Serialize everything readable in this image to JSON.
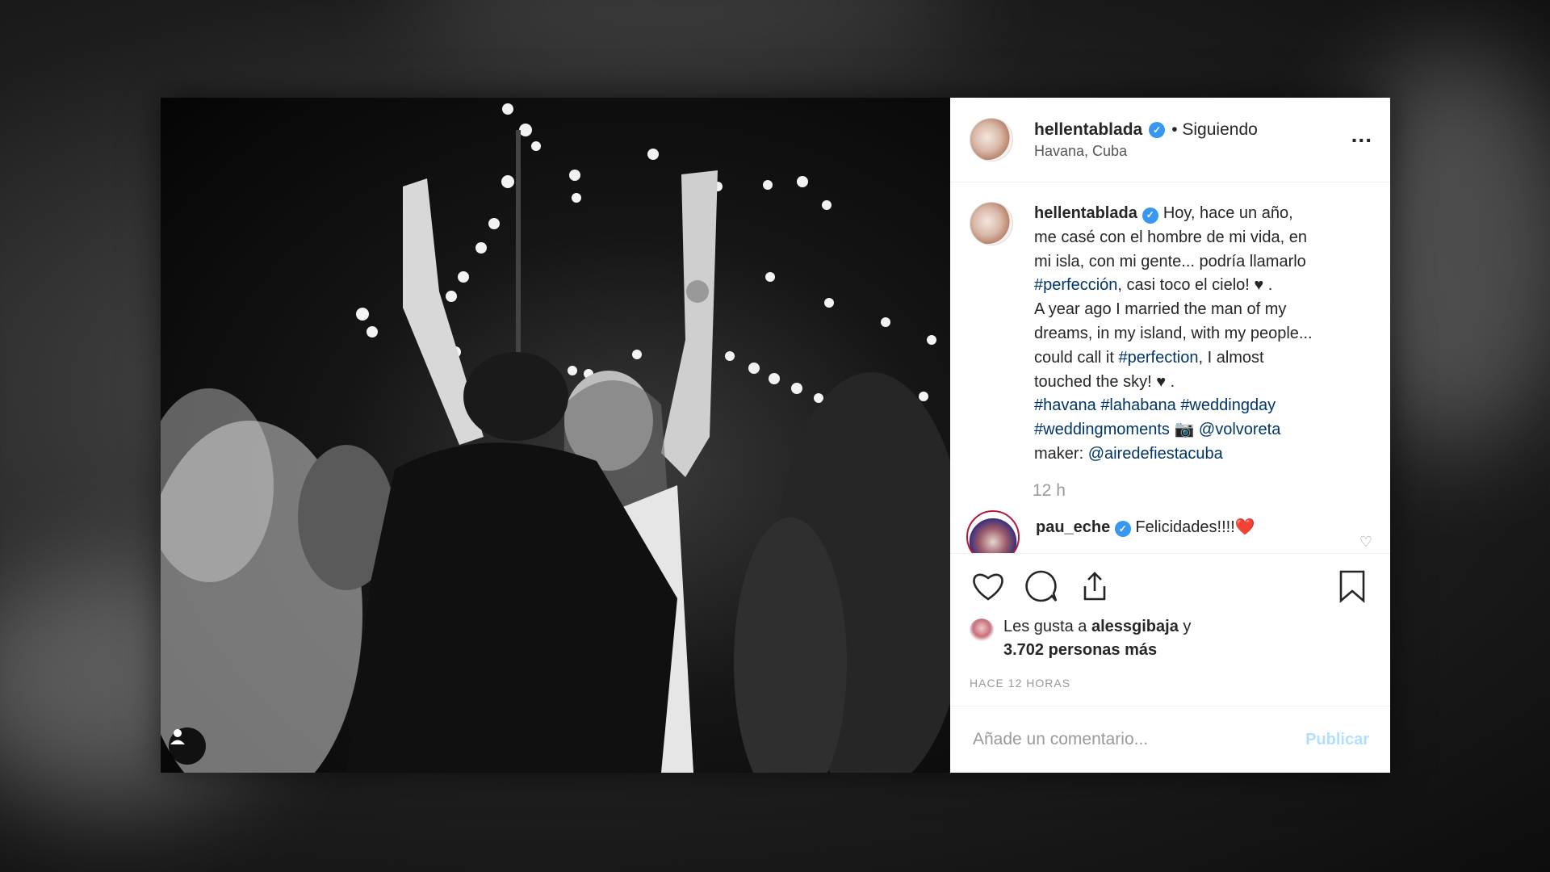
{
  "post": {
    "username": "hellentablada",
    "follow_status": "• Siguiendo",
    "location": "Havana, Cuba",
    "more_label": "...",
    "caption": {
      "username": "hellentablada",
      "line1": "Hoy, hace un año,",
      "line2": "me casé con el hombre de mi vida, en",
      "line3": "mi isla, con mi gente... podría llamarlo",
      "line4_tag": "#perfección",
      "line4_rest": ", casi toco el cielo! ♥ .",
      "line5": "A year ago I married the man of my",
      "line6": "dreams, in my island, with my people...",
      "line7_pre": "could call it ",
      "line7_tag": "#perfection",
      "line7_rest": ", I almost",
      "line8": "touched the sky! ♥ .",
      "tags_line1": [
        "#havana",
        "#lahabana",
        "#weddingday"
      ],
      "tags_line2_tag": "#weddingmoments",
      "camera_icon": "📷",
      "tags_line2_mention": "@volvoreta",
      "maker_label": "maker:",
      "maker_mention": "@airedefiestacuba"
    },
    "time_ago": "12 h",
    "comment": {
      "username": "pau_eche",
      "text": "Felicidades!!!!",
      "emoji": "❤️"
    },
    "likes": {
      "prefix": "Les gusta a ",
      "liker": "alessgibaja",
      "suffix": " y",
      "count_line": "3.702 personas más"
    },
    "timestamp": "HACE 12 HORAS",
    "comment_input": {
      "placeholder": "Añade un comentario...",
      "publish_label": "Publicar"
    },
    "verified_mark": "✓"
  },
  "colors": {
    "verified_blue": "#3897f0",
    "hashtag": "#003569",
    "publish_disabled": "#b2dffc"
  }
}
